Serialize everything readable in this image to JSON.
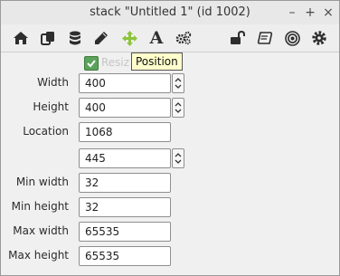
{
  "window": {
    "title": "stack \"Untitled 1\" (id 1002)",
    "controls": {
      "minimize": "–",
      "maximize": "+",
      "close": "×"
    }
  },
  "toolbar": {
    "icons": [
      "home-icon",
      "copy-icon",
      "database-icon",
      "pencil-icon",
      "move-icon",
      "text-icon",
      "gears-icon",
      "lock-icon",
      "script-icon",
      "target-icon",
      "gear-icon"
    ],
    "active": "move-icon",
    "accent_color": "#8cc43c",
    "text_glyph": "A"
  },
  "tooltip": {
    "text": "Position"
  },
  "resize": {
    "label": "Resiz",
    "checked": true
  },
  "fields": {
    "width": {
      "label": "Width",
      "value": "400"
    },
    "height": {
      "label": "Height",
      "value": "400"
    },
    "location": {
      "label": "Location",
      "value_x": "1068",
      "value_y": "445"
    },
    "min_width": {
      "label": "Min width",
      "value": "32"
    },
    "min_height": {
      "label": "Min height",
      "value": "32"
    },
    "max_width": {
      "label": "Max width",
      "value": "65535"
    },
    "max_height": {
      "label": "Max height",
      "value": "65535"
    }
  }
}
